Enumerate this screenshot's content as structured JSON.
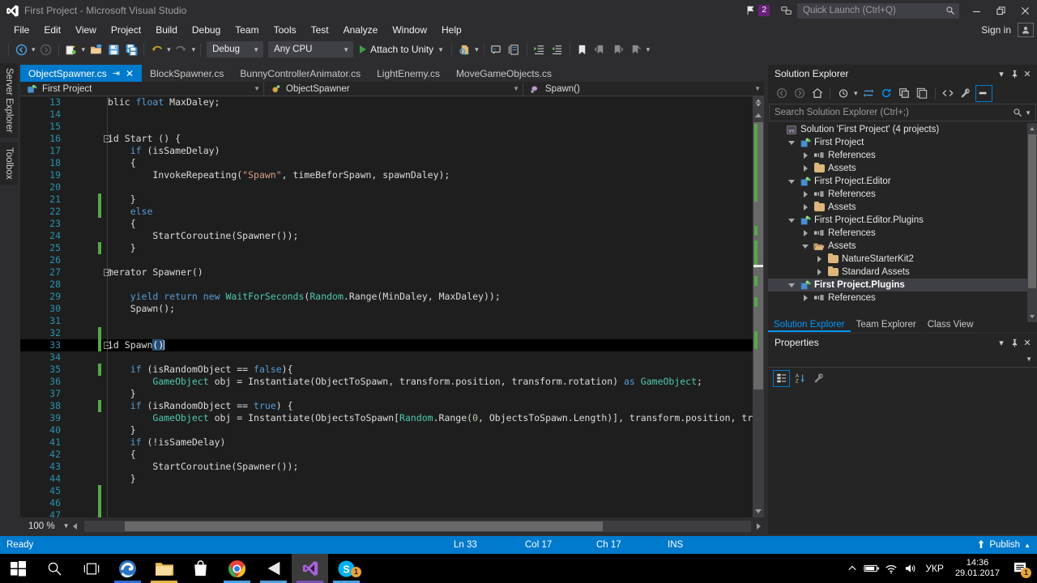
{
  "window": {
    "title": "First Project - Microsoft Visual Studio",
    "notification_count": "2",
    "minimize": "—",
    "restore": "❐",
    "close": "✕"
  },
  "quick_launch": {
    "placeholder": "Quick Launch (Ctrl+Q)",
    "value": ""
  },
  "account": {
    "sign_in": "Sign in"
  },
  "menu": {
    "items": [
      "File",
      "Edit",
      "View",
      "Project",
      "Build",
      "Debug",
      "Team",
      "Tools",
      "Test",
      "Analyze",
      "Window",
      "Help"
    ]
  },
  "toolbar": {
    "config": "Debug",
    "platform": "Any CPU",
    "attach_label": "Attach to Unity"
  },
  "vertical_tabs": [
    "Server Explorer",
    "Toolbox"
  ],
  "tabs": [
    {
      "label": "ObjectSpawner.cs",
      "active": true
    },
    {
      "label": "BlockSpawner.cs",
      "active": false
    },
    {
      "label": "BunnyControllerAnimator.cs",
      "active": false
    },
    {
      "label": "LightEnemy.cs",
      "active": false
    },
    {
      "label": "MoveGameObjects.cs",
      "active": false
    }
  ],
  "navbar": {
    "project": "First Project",
    "class": "ObjectSpawner",
    "member": "Spawn()"
  },
  "editor": {
    "zoom": "100 %",
    "lines": [
      {
        "n": "13",
        "indent": 0,
        "text": "blic float MaxDaley;",
        "clipped": true
      },
      {
        "n": "14",
        "text": ""
      },
      {
        "n": "15",
        "text": ""
      },
      {
        "n": "16",
        "text": "id Start () {",
        "fold": true,
        "clipped": true
      },
      {
        "n": "17",
        "text": "    if (isSameDelay)"
      },
      {
        "n": "18",
        "text": "    {"
      },
      {
        "n": "19",
        "text": "        InvokeRepeating(\"Spawn\", timeBeforSpawn, spawnDaley);"
      },
      {
        "n": "20",
        "text": ""
      },
      {
        "n": "21",
        "text": "    }",
        "change": true
      },
      {
        "n": "22",
        "text": "    else",
        "change": true
      },
      {
        "n": "23",
        "text": "    {"
      },
      {
        "n": "24",
        "text": "        StartCoroutine(Spawner());"
      },
      {
        "n": "25",
        "text": "    }",
        "change": true
      },
      {
        "n": "26",
        "text": ""
      },
      {
        "n": "27",
        "text": "merator Spawner()",
        "fold": true,
        "clipped": true
      },
      {
        "n": "28",
        "text": ""
      },
      {
        "n": "29",
        "text": "    yield return new WaitForSeconds(Random.Range(MinDaley, MaxDaley));"
      },
      {
        "n": "30",
        "text": "    Spawn();"
      },
      {
        "n": "31",
        "text": ""
      },
      {
        "n": "32",
        "text": "",
        "change": true
      },
      {
        "n": "33",
        "text": "id Spawn()",
        "fold": true,
        "clipped": true,
        "current": true,
        "change": true
      },
      {
        "n": "34",
        "text": ""
      },
      {
        "n": "35",
        "text": "    if (isRandomObject == false){",
        "change": true
      },
      {
        "n": "36",
        "text": "        GameObject obj = Instantiate(ObjectToSpawn, transform.position, transform.rotation) as GameObject;"
      },
      {
        "n": "37",
        "text": "    }"
      },
      {
        "n": "38",
        "text": "    if (isRandomObject == true) {",
        "change": true
      },
      {
        "n": "39",
        "text": "        GameObject obj = Instantiate(ObjectsToSpawn[Random.Range(0, ObjectsToSpawn.Length)], transform.position, transform.rot"
      },
      {
        "n": "40",
        "text": "    }"
      },
      {
        "n": "41",
        "text": "    if (!isSameDelay)"
      },
      {
        "n": "42",
        "text": "    {"
      },
      {
        "n": "43",
        "text": "        StartCoroutine(Spawner());"
      },
      {
        "n": "44",
        "text": "    }"
      },
      {
        "n": "45",
        "text": "",
        "change": true
      },
      {
        "n": "46",
        "text": "",
        "change": true
      },
      {
        "n": "47",
        "text": "",
        "change": true
      }
    ]
  },
  "solution_explorer": {
    "title": "Solution Explorer",
    "search_placeholder": "Search Solution Explorer (Ctrl+;)",
    "search_value": "",
    "tree": [
      {
        "label": "Solution 'First Project' (4 projects)",
        "depth": 0,
        "icon": "solution-icon",
        "expander": "none"
      },
      {
        "label": "First Project",
        "depth": 1,
        "icon": "project-icon",
        "expander": "down"
      },
      {
        "label": "References",
        "depth": 2,
        "icon": "references-icon",
        "expander": "right"
      },
      {
        "label": "Assets",
        "depth": 2,
        "icon": "folder-icon",
        "expander": "right"
      },
      {
        "label": "First Project.Editor",
        "depth": 1,
        "icon": "project-icon",
        "expander": "down"
      },
      {
        "label": "References",
        "depth": 2,
        "icon": "references-icon",
        "expander": "right"
      },
      {
        "label": "Assets",
        "depth": 2,
        "icon": "folder-icon",
        "expander": "right"
      },
      {
        "label": "First Project.Editor.Plugins",
        "depth": 1,
        "icon": "project-icon",
        "expander": "down"
      },
      {
        "label": "References",
        "depth": 2,
        "icon": "references-icon",
        "expander": "right"
      },
      {
        "label": "Assets",
        "depth": 2,
        "icon": "folder-open-icon",
        "expander": "down"
      },
      {
        "label": "NatureStarterKit2",
        "depth": 3,
        "icon": "folder-icon",
        "expander": "right"
      },
      {
        "label": "Standard Assets",
        "depth": 3,
        "icon": "folder-icon",
        "expander": "right"
      },
      {
        "label": "First Project.Plugins",
        "depth": 1,
        "icon": "project-icon",
        "expander": "down",
        "selected": true
      },
      {
        "label": "References",
        "depth": 2,
        "icon": "references-icon",
        "expander": "right"
      }
    ]
  },
  "panel_tabs": [
    {
      "label": "Solution Explorer",
      "active": true
    },
    {
      "label": "Team Explorer",
      "active": false
    },
    {
      "label": "Class View",
      "active": false
    }
  ],
  "properties": {
    "title": "Properties"
  },
  "statusbar": {
    "ready": "Ready",
    "line": "Ln 33",
    "col": "Col 17",
    "ch": "Ch 17",
    "ins": "INS",
    "publish": "Publish"
  },
  "taskbar": {
    "items": [
      {
        "name": "start-button",
        "icon": "windows-logo"
      },
      {
        "name": "search-button",
        "icon": "search"
      },
      {
        "name": "task-view-button",
        "icon": "task-view"
      },
      {
        "name": "edge-button",
        "icon": "edge"
      },
      {
        "name": "file-explorer-button",
        "icon": "folder"
      },
      {
        "name": "store-button",
        "icon": "store"
      },
      {
        "name": "chrome-button",
        "icon": "chrome"
      },
      {
        "name": "unity-button",
        "icon": "unity"
      },
      {
        "name": "visual-studio-button",
        "icon": "visual-studio"
      },
      {
        "name": "skype-button",
        "icon": "skype"
      }
    ],
    "language": "УКР",
    "time": "14:36",
    "date": "29.01.2017",
    "notification_count": "1"
  },
  "colors": {
    "accent": "#007acc",
    "editor_bg": "#1e1e1e",
    "chrome_bg": "#2d2d30",
    "panel_bg": "#252526",
    "keyword": "#569cd6",
    "type": "#4ec9b0",
    "string": "#d69d85",
    "number": "#b5cea8",
    "linenum": "#2b91af",
    "selection": "#264f78",
    "change_marker": "#57a64a"
  }
}
